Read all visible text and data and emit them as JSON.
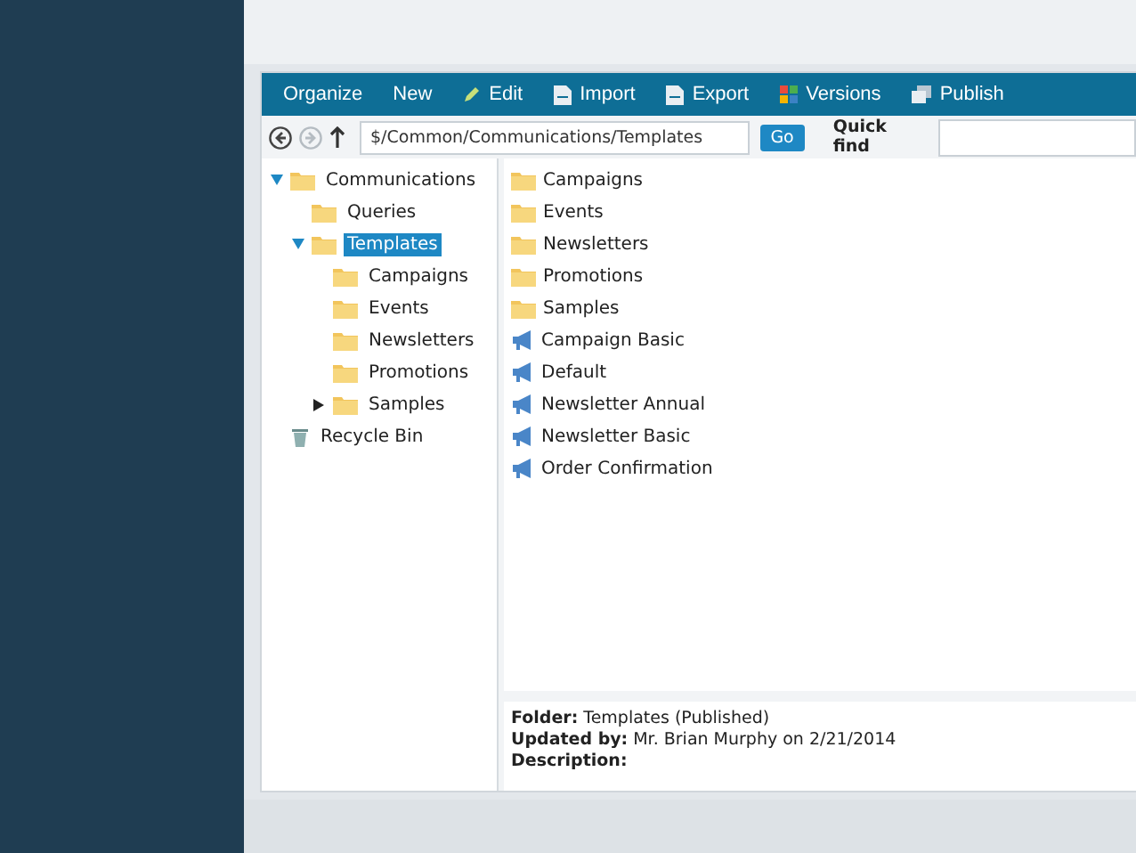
{
  "toolbar": {
    "items": [
      {
        "label": "Organize",
        "kind": "text"
      },
      {
        "label": "New",
        "kind": "text"
      },
      {
        "label": "Edit",
        "kind": "edit"
      },
      {
        "label": "Import",
        "kind": "import"
      },
      {
        "label": "Export",
        "kind": "export"
      },
      {
        "label": "Versions",
        "kind": "versions"
      },
      {
        "label": "Publish",
        "kind": "publish"
      }
    ]
  },
  "navigation": {
    "back": {
      "disabled": false
    },
    "forward": {
      "disabled": true
    },
    "path": "$/Common/Communications/Templates",
    "go_button": "Go",
    "quick_find": {
      "label": "Quick find"
    }
  },
  "tree": [
    {
      "label": "Communications",
      "kind": "folder",
      "expanded": true,
      "selected": false,
      "children": [
        {
          "label": "Queries",
          "kind": "folder",
          "selected": false
        },
        {
          "label": "Templates",
          "kind": "folder",
          "expanded": true,
          "selected": true,
          "children": [
            {
              "label": "Campaigns",
              "kind": "folder",
              "selected": false
            },
            {
              "label": "Events",
              "kind": "folder",
              "selected": false
            },
            {
              "label": "Newsletters",
              "kind": "folder",
              "selected": false
            },
            {
              "label": "Promotions",
              "kind": "folder",
              "selected": false
            },
            {
              "label": "Samples",
              "kind": "folder",
              "expanded": false,
              "selected": false
            }
          ]
        }
      ]
    },
    {
      "label": "Recycle Bin",
      "kind": "bin",
      "selected": false
    }
  ],
  "items": [
    {
      "label": "Campaigns",
      "kind": "folder"
    },
    {
      "label": "Events",
      "kind": "folder"
    },
    {
      "label": "Newsletters",
      "kind": "folder"
    },
    {
      "label": "Promotions",
      "kind": "folder"
    },
    {
      "label": "Samples",
      "kind": "folder"
    },
    {
      "label": "Campaign Basic",
      "kind": "template"
    },
    {
      "label": "Default",
      "kind": "template"
    },
    {
      "label": "Newsletter Annual",
      "kind": "template"
    },
    {
      "label": "Newsletter Basic",
      "kind": "template"
    },
    {
      "label": "Order Confirmation",
      "kind": "template"
    }
  ],
  "details": [
    {
      "label": "Folder:",
      "value": "Templates (Published)"
    },
    {
      "label": "Updated by:",
      "value": "Mr. Brian Murphy on 2/21/2014"
    },
    {
      "label": "Description:"
    }
  ]
}
